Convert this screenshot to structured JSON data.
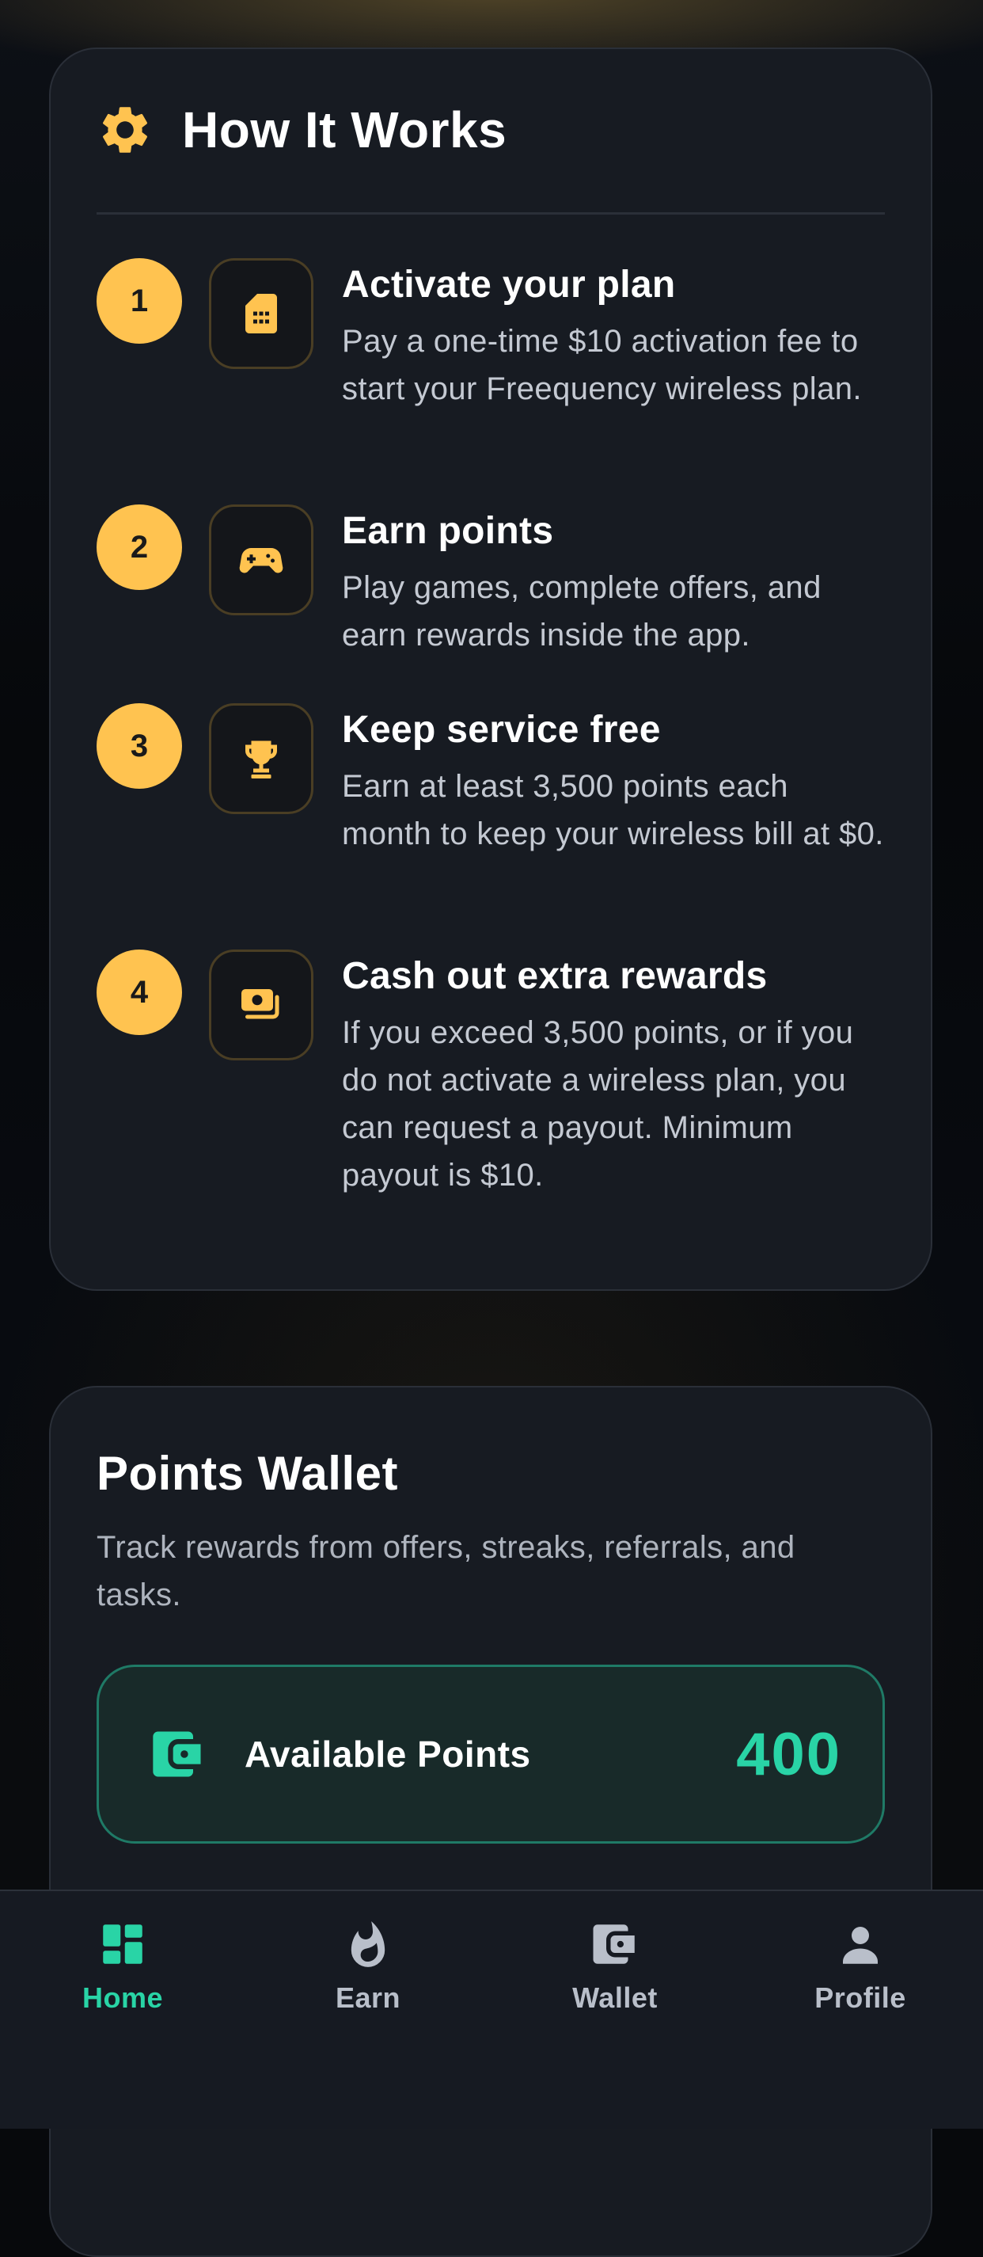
{
  "colors": {
    "accent_gold": "#ffc350",
    "accent_green": "#29d4a6",
    "card_bg": "#171b22",
    "text_muted": "#c4c9d2"
  },
  "how_it_works": {
    "title": "How It Works",
    "icon": "gear-icon",
    "steps": [
      {
        "number": "1",
        "icon": "sim-card-icon",
        "title": "Activate your plan",
        "description": "Pay a one-time $10 activation fee to start your Freequency wireless plan."
      },
      {
        "number": "2",
        "icon": "gamepad-icon",
        "title": "Earn points",
        "description": "Play games, complete offers, and earn rewards inside the app."
      },
      {
        "number": "3",
        "icon": "trophy-icon",
        "title": "Keep service free",
        "description": "Earn at least 3,500 points each month to keep your wireless bill at $0."
      },
      {
        "number": "4",
        "icon": "cash-icon",
        "title": "Cash out extra rewards",
        "description": "If you exceed 3,500 points, or if you do not activate a wireless plan, you can request a payout. Minimum payout is $10."
      }
    ]
  },
  "points_wallet": {
    "title": "Points Wallet",
    "description": "Track rewards from offers, streaks, referrals, and tasks.",
    "available_label": "Available Points",
    "available_value": "400",
    "icon": "wallet-icon"
  },
  "nav": {
    "active": "Home",
    "items": [
      {
        "label": "Home",
        "icon": "dashboard-icon"
      },
      {
        "label": "Earn",
        "icon": "flame-icon"
      },
      {
        "label": "Wallet",
        "icon": "wallet-icon"
      },
      {
        "label": "Profile",
        "icon": "person-icon"
      }
    ]
  }
}
